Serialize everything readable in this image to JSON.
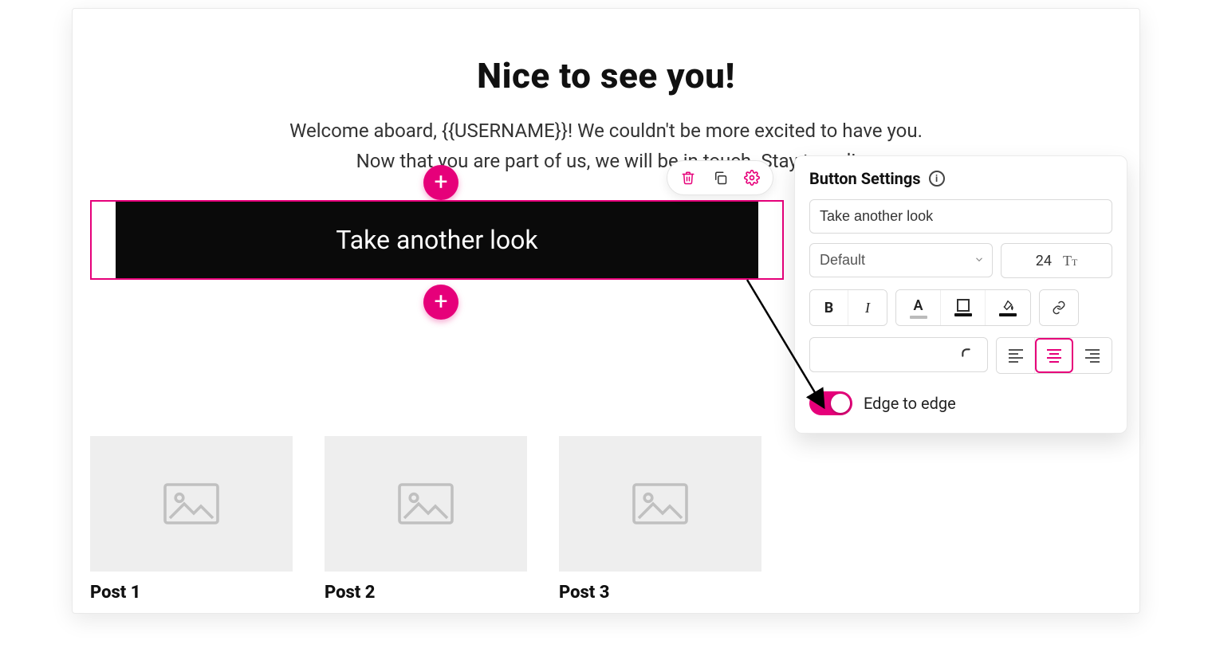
{
  "header": {
    "title": "Nice to see you!"
  },
  "intro": {
    "line1": "Welcome aboard, {{USERNAME}}! We couldn't be more excited to have you.",
    "line2": "Now that you are part of us, we will be in touch. Stay tuned!"
  },
  "button_block": {
    "label": "Take another look"
  },
  "toolbar": {
    "delete": "Delete",
    "duplicate": "Duplicate",
    "settings": "Settings"
  },
  "panel": {
    "title": "Button Settings",
    "text_value": "Take another look",
    "font_family": "Default",
    "font_size": "24",
    "edge_to_edge_label": "Edge to edge",
    "edge_to_edge_on": true,
    "format": {
      "bold": "B",
      "italic": "I",
      "text_color": "A",
      "link": "link"
    },
    "alignment": "center"
  },
  "posts": [
    {
      "title": "Post 1"
    },
    {
      "title": "Post 2"
    },
    {
      "title": "Post 3"
    }
  ],
  "colors": {
    "accent": "#e6007a"
  }
}
